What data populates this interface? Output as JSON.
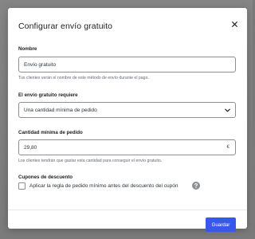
{
  "modal": {
    "title": "Configurar envío gratuito",
    "close_icon": "close-icon"
  },
  "name_field": {
    "label": "Nombre",
    "value": "Envío gratuito",
    "help": "Tus clientes verán el nombre de este método de envío durante el pago."
  },
  "requires_field": {
    "label": "El envío gratuito requiere",
    "selected": "Una cantidad mínima de pedido",
    "chevron_icon": "chevron-down-icon"
  },
  "min_amount_field": {
    "label": "Cantidad mínima de pedido",
    "value": "29,80",
    "currency": "€",
    "help": "Los clientes tendrán que gastar esta cantidad para conseguir el envío gratuito."
  },
  "coupons": {
    "label": "Cupones de descuento",
    "checkbox_label": "Aplicar la regla de pedido mínimo antes del descuento del cupón",
    "checked": false,
    "help_icon": "help-icon"
  },
  "footer": {
    "save_label": "Guardar"
  },
  "colors": {
    "primary": "#3858e9",
    "backdrop": "#7b7b7b"
  }
}
